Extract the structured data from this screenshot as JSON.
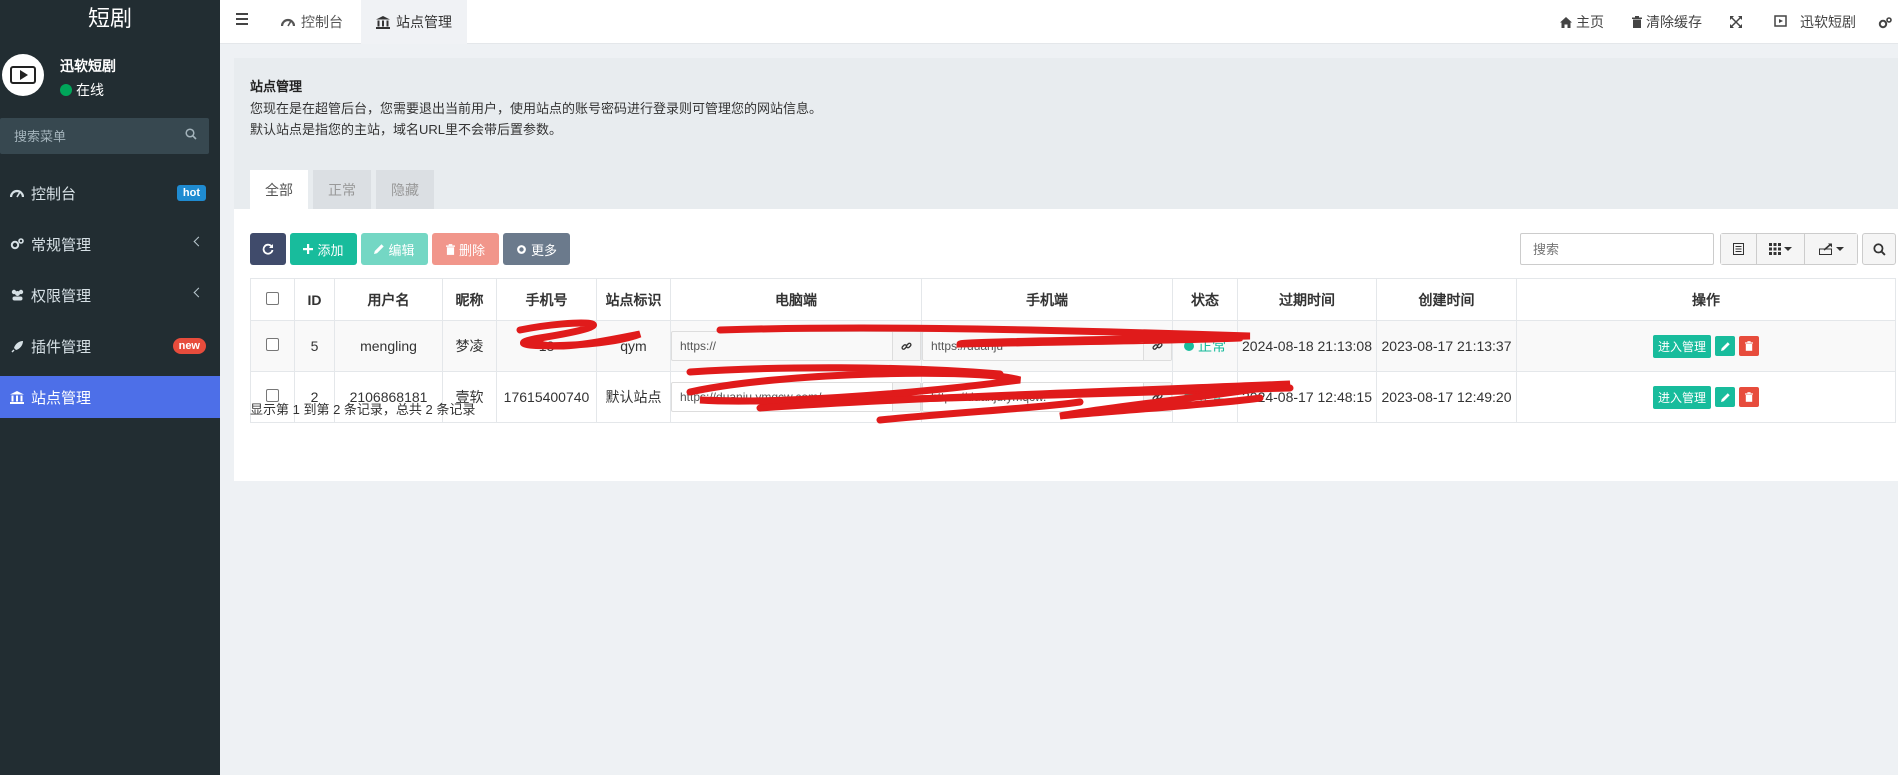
{
  "app": {
    "title": "短剧",
    "user_name": "迅软短剧",
    "user_status": "在线",
    "menu_search_placeholder": "搜索菜单"
  },
  "sidebar": {
    "items": [
      {
        "label": "控制台",
        "icon": "dashboard-icon",
        "badge": "hot"
      },
      {
        "label": "常规管理",
        "icon": "cogs-icon"
      },
      {
        "label": "权限管理",
        "icon": "users-icon"
      },
      {
        "label": "插件管理",
        "icon": "rocket-icon",
        "badge": "new"
      },
      {
        "label": "站点管理",
        "icon": "bank-icon",
        "active": true
      }
    ]
  },
  "topbar": {
    "tabs": [
      {
        "label": "控制台",
        "icon": "dashboard-icon"
      },
      {
        "label": "站点管理",
        "icon": "bank-icon",
        "active": true
      }
    ],
    "nav": {
      "home": "主页",
      "clear_cache": "清除缓存",
      "user": "迅软短剧"
    }
  },
  "panel": {
    "title": "站点管理",
    "desc_line1": "您现在是在超管后台，您需要退出当前用户，使用站点的账号密码进行登录则可管理您的网站信息。",
    "desc_line2": "默认站点是指您的主站，域名URL里不会带后置参数。",
    "tabs": [
      "全部",
      "正常",
      "隐藏"
    ]
  },
  "toolbar": {
    "add": "添加",
    "edit": "编辑",
    "delete": "删除",
    "more": "更多",
    "search_placeholder": "搜索"
  },
  "table": {
    "headers": [
      "ID",
      "用户名",
      "昵称",
      "手机号",
      "站点标识",
      "电脑端",
      "手机端",
      "状态",
      "过期时间",
      "创建时间",
      "操作"
    ],
    "rows": [
      {
        "id": "5",
        "username": "mengling",
        "nickname": "梦凌",
        "phone": "18",
        "site_key": "qym",
        "pc_url": "https://",
        "mobile_url": "https://duanju",
        "status": "正常",
        "expire": "2024-08-18 21:13:08",
        "created": "2023-08-17 21:13:37",
        "enter": "进入管理"
      },
      {
        "id": "2",
        "username": "2106868181",
        "nickname": "壹软",
        "phone": "17615400740",
        "site_key": "默认站点",
        "pc_url": "https://duanju.ymqcw.com/",
        "mobile_url": "https://duanju.ymqcw.",
        "status": "正常",
        "expire": "2024-08-17 12:48:15",
        "created": "2023-08-17 12:49:20",
        "enter": "进入管理"
      }
    ]
  },
  "pagination": {
    "info": "显示第 1 到第 2 条记录，总共 2 条记录"
  },
  "colors": {
    "sidebar_bg": "#222d32",
    "active_menu": "#4d6fe8",
    "success": "#18bc9c",
    "danger": "#e74c3c",
    "redaction": "#e01b1b"
  }
}
